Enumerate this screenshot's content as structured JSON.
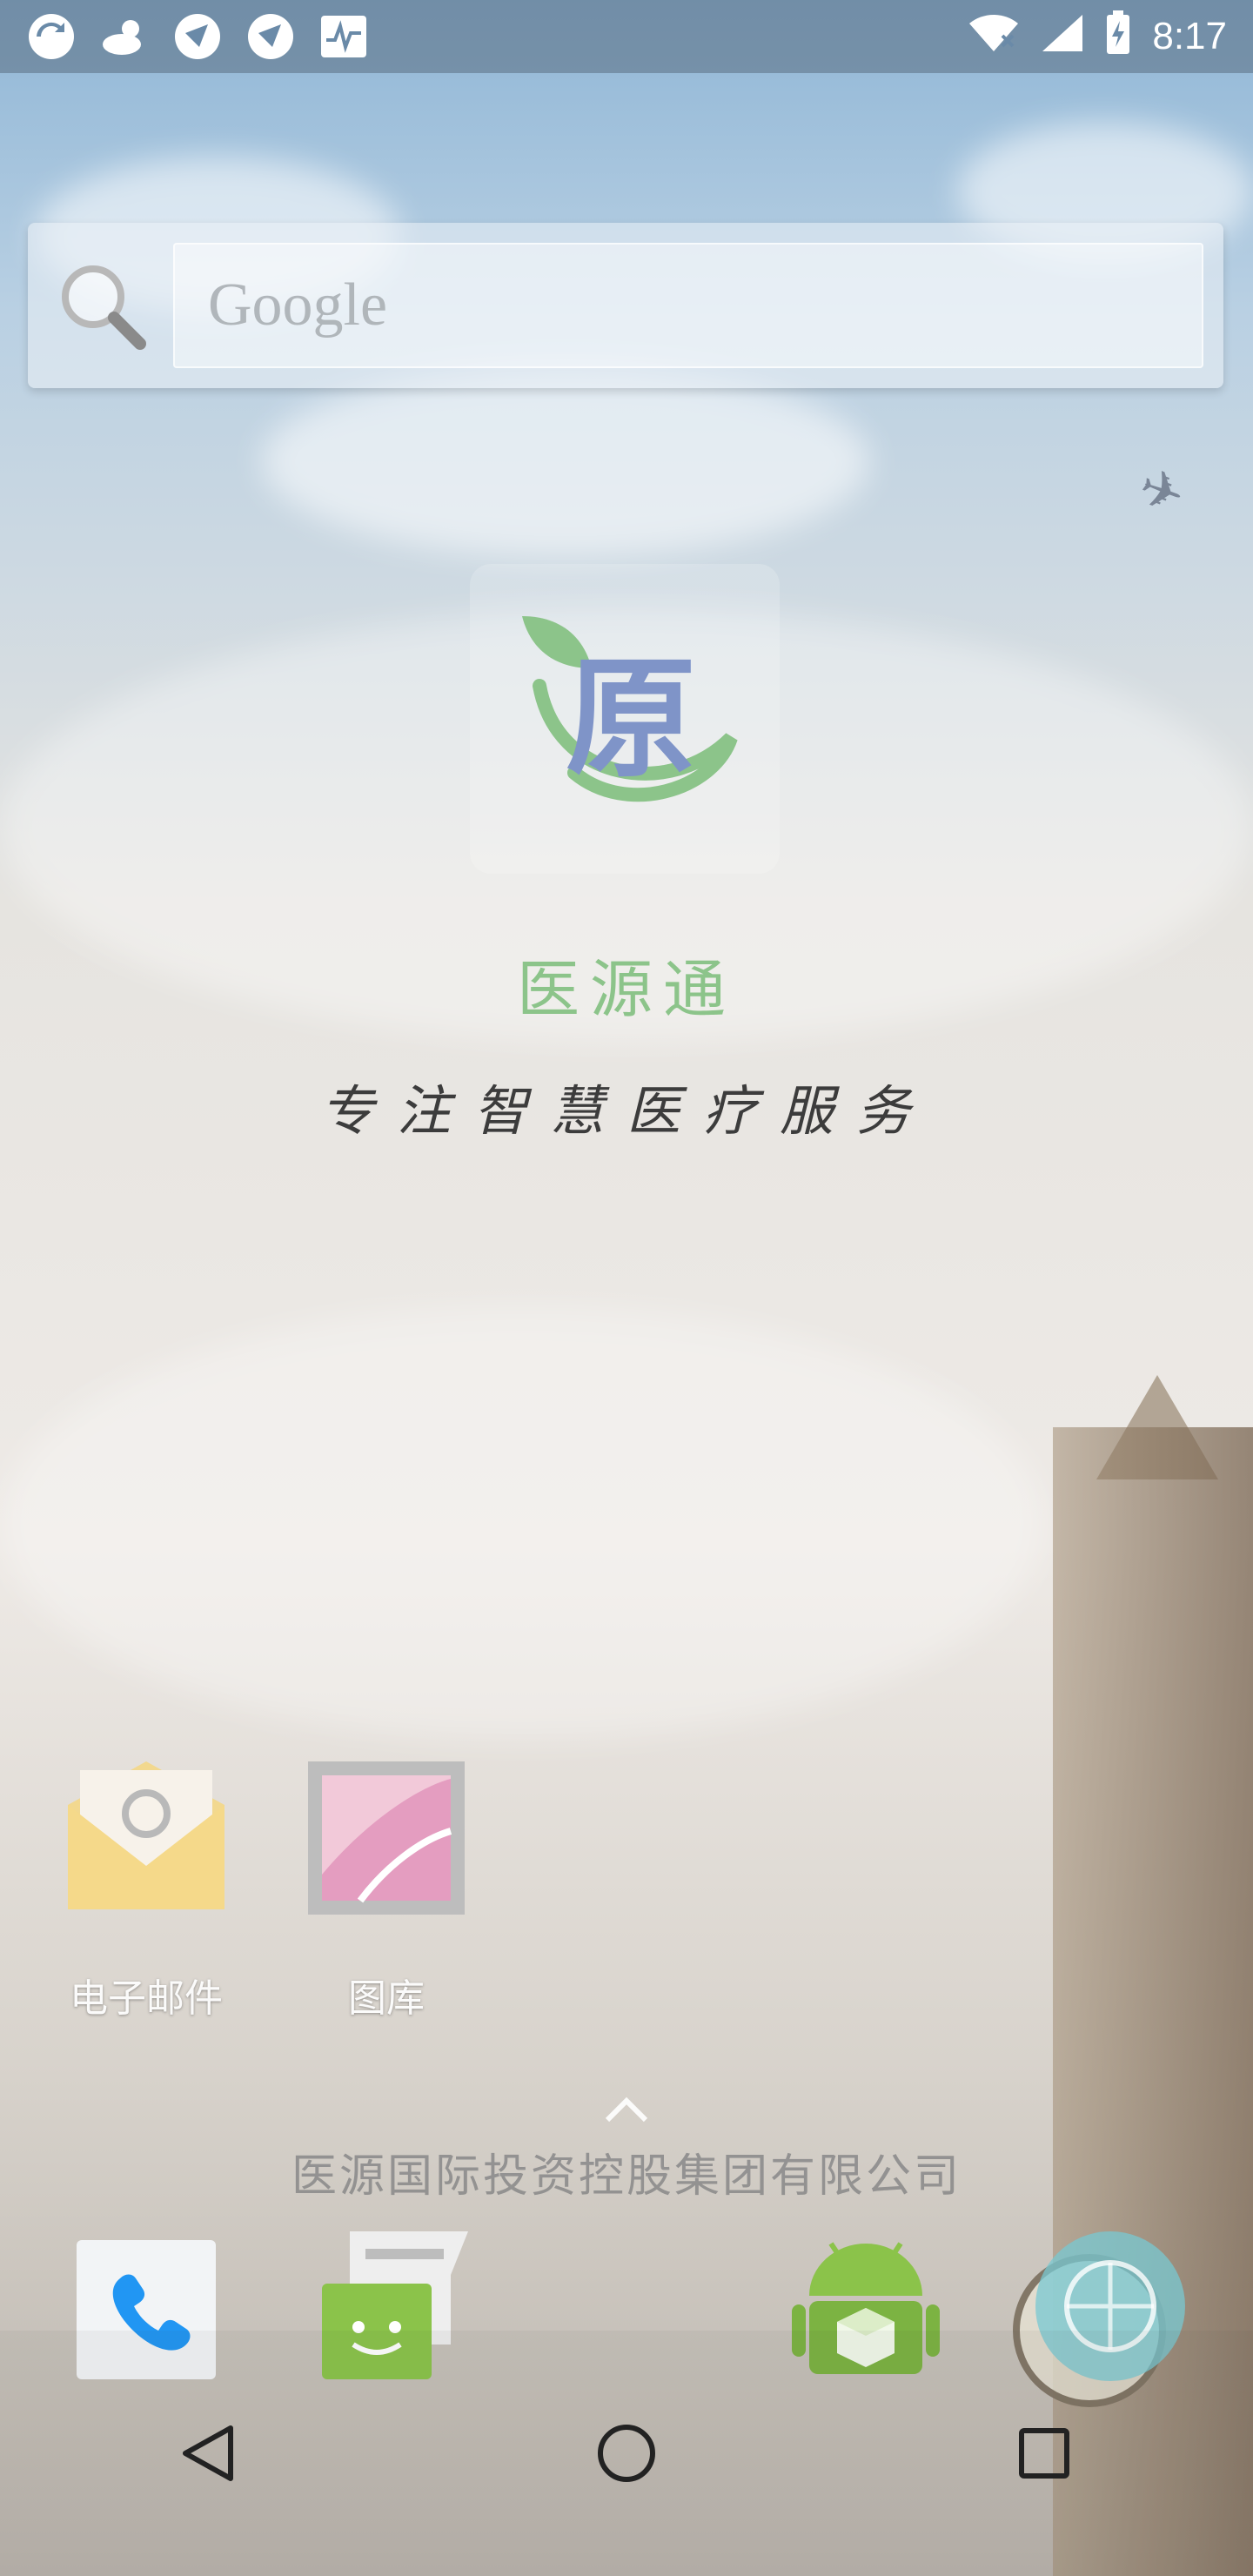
{
  "status_bar": {
    "left_icons": [
      "sync-icon",
      "weather-icon",
      "app-icon",
      "app-icon-2",
      "pulse-icon"
    ],
    "right_icons": [
      "wifi-icon",
      "signal-icon",
      "battery-charging-icon"
    ],
    "time": "8:17"
  },
  "search_widget": {
    "placeholder": "Google"
  },
  "logo_widget": {
    "logo_text": "原",
    "app_name": "医源通",
    "slogan": "专注智慧医疗服务"
  },
  "home_icons": [
    {
      "label": "电子邮件",
      "icon": "email-icon"
    },
    {
      "label": "图库",
      "icon": "gallery-icon"
    }
  ],
  "drawer": {
    "company": "医源国际投资控股集团有限公司"
  },
  "dock": [
    {
      "icon": "phone-icon"
    },
    {
      "icon": "messaging-icon"
    },
    {
      "icon": "android-store-icon"
    },
    {
      "icon": "browser-icon"
    }
  ],
  "nav": [
    "back-icon",
    "home-icon",
    "recents-icon"
  ],
  "colors": {
    "brand_green": "#8cc48a",
    "logo_blue": "#7f94c8"
  }
}
